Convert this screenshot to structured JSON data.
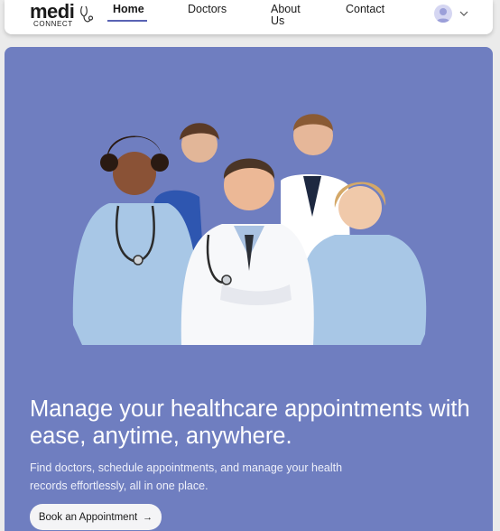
{
  "brand": {
    "name": "medi",
    "sub": "CONNECT"
  },
  "nav": {
    "home": "Home",
    "doctors": "Doctors",
    "about": "About Us",
    "contact": "Contact"
  },
  "hero": {
    "title": "Manage your healthcare appointments with ease, anytime, anywhere.",
    "subtitle": "Find doctors, schedule appointments, and manage your health records effortlessly, all in one place.",
    "cta_label": "Book an Appointment",
    "cta_icon": "arrow-right-icon"
  },
  "colors": {
    "hero_bg": "#6f7ec0",
    "accent": "#5963b4",
    "navbar_bg": "#ffffff"
  }
}
